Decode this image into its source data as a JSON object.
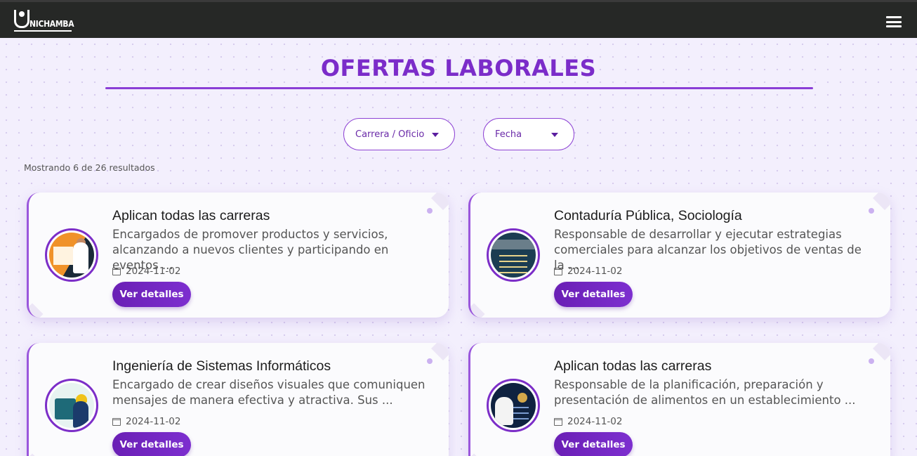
{
  "navbar": {
    "logo_text": "NICHAMBA",
    "menu_icon": "hamburger-menu-icon"
  },
  "page": {
    "title": "OFERTAS LABORALES"
  },
  "filters": {
    "career_label": "Carrera / Oficio",
    "date_label": "Fecha"
  },
  "results": {
    "count_text": "Mostrando 6 de 26 resultados"
  },
  "colors": {
    "accent": "#7b2cc9",
    "navbar": "#262826",
    "button": "#6a1fb5"
  },
  "jobs": [
    {
      "career": "Aplican todas las carreras",
      "description": "Encargados de promover productos y servicios, alcanzando a nuevos clientes y participando en eventos ...",
      "date": "2024-11-02",
      "button_label": "Ver detalles"
    },
    {
      "career": "Contaduría Pública, Sociología",
      "description": "Responsable de desarrollar y ejecutar estrategias comerciales para alcanzar los objetivos de ventas de la ...",
      "date": "2024-11-02",
      "button_label": "Ver detalles"
    },
    {
      "career": "Ingeniería de Sistemas Informáticos",
      "description": "Encargado de crear diseños visuales que comuniquen mensajes de manera efectiva y atractiva. Sus ...",
      "date": "2024-11-02",
      "button_label": "Ver detalles"
    },
    {
      "career": "Aplican todas las carreras",
      "description": "Responsable de la planificación, preparación y presentación de alimentos en un establecimiento ...",
      "date": "2024-11-02",
      "button_label": "Ver detalles"
    }
  ]
}
